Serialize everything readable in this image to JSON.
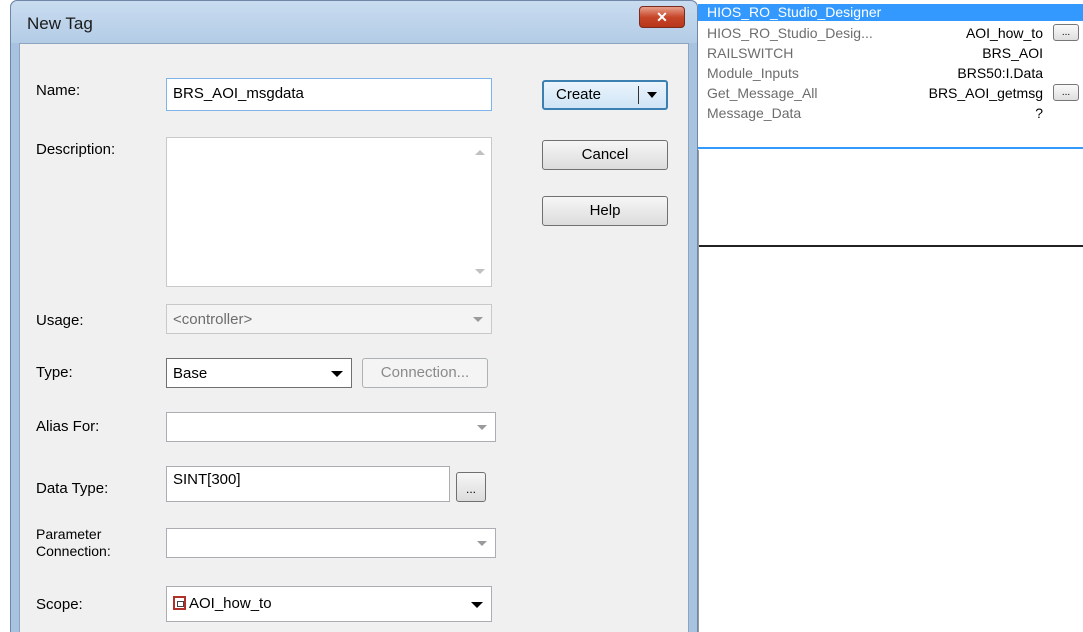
{
  "dialog": {
    "title": "New Tag",
    "close_label": "✕",
    "name": {
      "label": "Name:",
      "value": "BRS_AOI_msgdata"
    },
    "description": {
      "label": "Description:",
      "value": ""
    },
    "usage": {
      "label": "Usage:",
      "value": "<controller>"
    },
    "type": {
      "label": "Type:",
      "value": "Base",
      "connection_label": "Connection..."
    },
    "alias_for": {
      "label": "Alias For:",
      "value": ""
    },
    "data_type": {
      "label": "Data Type:",
      "value": "SINT[300]",
      "browse_label": "..."
    },
    "parameter_connection": {
      "label_line1": "Parameter",
      "label_line2": "Connection:",
      "value": ""
    },
    "scope": {
      "label": "Scope:",
      "value": "AOI_how_to"
    },
    "buttons": {
      "create": "Create",
      "cancel": "Cancel",
      "help": "Help"
    }
  },
  "panel": {
    "header": "HIOS_RO_Studio_Designer",
    "rows": [
      {
        "name": "HIOS_RO_Studio_Desig...",
        "value": "AOI_how_to",
        "button": "..."
      },
      {
        "name": "RAILSWITCH",
        "value": "BRS_AOI",
        "button": ""
      },
      {
        "name": "Module_Inputs",
        "value": "BRS50:I.Data",
        "button": ""
      },
      {
        "name": "Get_Message_All",
        "value": "BRS_AOI_getmsg",
        "button": "..."
      },
      {
        "name": "Message_Data",
        "value": "?",
        "button": ""
      }
    ]
  },
  "colors": {
    "selection_blue": "#3399ff",
    "dialog_frame": "#a7c3e0",
    "close_red": "#c7472b"
  }
}
